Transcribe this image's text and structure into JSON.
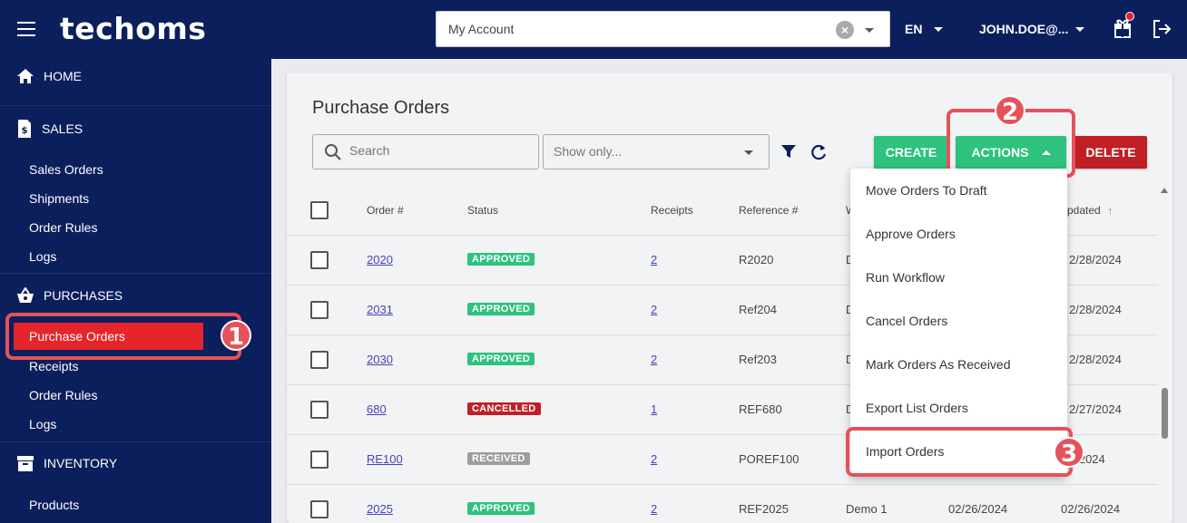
{
  "header": {
    "logo": "techoms",
    "account_value": "My Account",
    "language": "EN",
    "user": "JOHN.DOE@..."
  },
  "sidebar": {
    "home": "HOME",
    "sales": {
      "label": "SALES",
      "items": [
        "Sales Orders",
        "Shipments",
        "Order Rules",
        "Logs"
      ]
    },
    "purchases": {
      "label": "PURCHASES",
      "items": [
        "Purchase Orders",
        "Receipts",
        "Order Rules",
        "Logs"
      ]
    },
    "inventory": {
      "label": "INVENTORY",
      "items": [
        "Products"
      ]
    }
  },
  "main": {
    "title": "Purchase Orders",
    "search_placeholder": "Search",
    "show_only_placeholder": "Show only...",
    "buttons": {
      "create": "CREATE",
      "actions": "ACTIONS",
      "delete": "DELETE"
    },
    "columns": [
      "Order #",
      "Status",
      "Receipts",
      "Reference #",
      "W",
      "pdated"
    ],
    "rows": [
      {
        "order": "2020",
        "status": "APPROVED",
        "status_type": "approved",
        "receipts": "2",
        "reference": "R2020",
        "w": "D",
        "updated": "2/28/2024"
      },
      {
        "order": "2031",
        "status": "APPROVED",
        "status_type": "approved",
        "receipts": "2",
        "reference": "Ref204",
        "w": "D",
        "updated": "2/28/2024"
      },
      {
        "order": "2030",
        "status": "APPROVED",
        "status_type": "approved",
        "receipts": "2",
        "reference": "Ref203",
        "w": "D",
        "updated": "2/28/2024"
      },
      {
        "order": "680",
        "status": "CANCELLED",
        "status_type": "cancelled",
        "receipts": "1",
        "reference": "REF680",
        "w": "D",
        "updated": "2/27/2024"
      },
      {
        "order": "RE100",
        "status": "RECEIVED",
        "status_type": "received",
        "receipts": "2",
        "reference": "POREF100",
        "w": "",
        "updated": "7/2024"
      },
      {
        "order": "2025",
        "status": "APPROVED",
        "status_type": "approved",
        "receipts": "2",
        "reference": "REF2025",
        "w": "Demo 1",
        "created": "02/26/2024",
        "updated": "02/26/2024"
      }
    ]
  },
  "actions_menu": [
    "Move Orders To Draft",
    "Approve Orders",
    "Run Workflow",
    "Cancel Orders",
    "Mark Orders As Received",
    "Export List Orders",
    "Import Orders"
  ],
  "callouts": [
    "1",
    "2",
    "3"
  ],
  "colors": {
    "nav": "#0b1f5c",
    "green": "#2ec27e",
    "red": "#c01f25",
    "highlight": "#e5525a"
  }
}
